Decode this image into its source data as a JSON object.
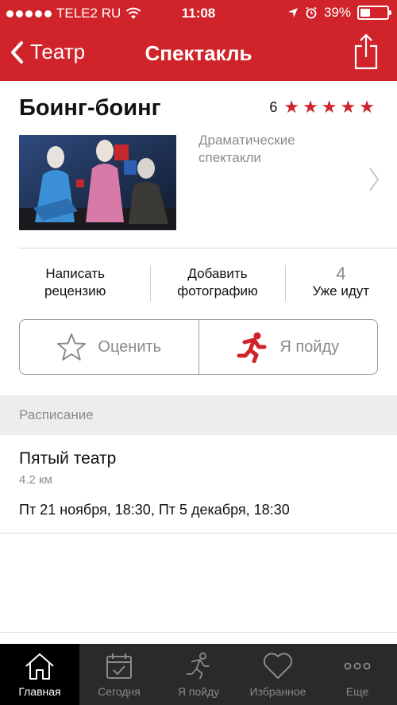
{
  "status_bar": {
    "carrier": "TELE2 RU",
    "time": "11:08",
    "battery": "39%",
    "battery_level": 0.39
  },
  "nav": {
    "back_label": "Театр",
    "title": "Спектакль"
  },
  "event": {
    "title": "Боинг-боинг",
    "rating_count": "6",
    "stars": 5,
    "genre": "Драматические спектакли"
  },
  "actions": {
    "write_review": "Написать рецензию",
    "add_photo": "Добавить фотографию",
    "going_count": "4",
    "going_label": "Уже идут"
  },
  "buttons": {
    "rate": "Оценить",
    "will_go": "Я пойду"
  },
  "schedule": {
    "header": "Расписание",
    "venue_name": "Пятый театр",
    "venue_distance": "4.2 км",
    "dates": "Пт 21 ноября, 18:30, Пт 5 декабря, 18:30"
  },
  "tabs": [
    {
      "label": "Главная",
      "icon": "home-icon",
      "active": true
    },
    {
      "label": "Сегодня",
      "icon": "calendar-icon",
      "active": false
    },
    {
      "label": "Я пойду",
      "icon": "runner-icon",
      "active": false
    },
    {
      "label": "Избранное",
      "icon": "heart-icon",
      "active": false
    },
    {
      "label": "Еще",
      "icon": "more-icon",
      "active": false
    }
  ],
  "colors": {
    "brand": "#d0232a",
    "tabbar": "#2a2a2a",
    "muted": "#8c8c8c"
  }
}
